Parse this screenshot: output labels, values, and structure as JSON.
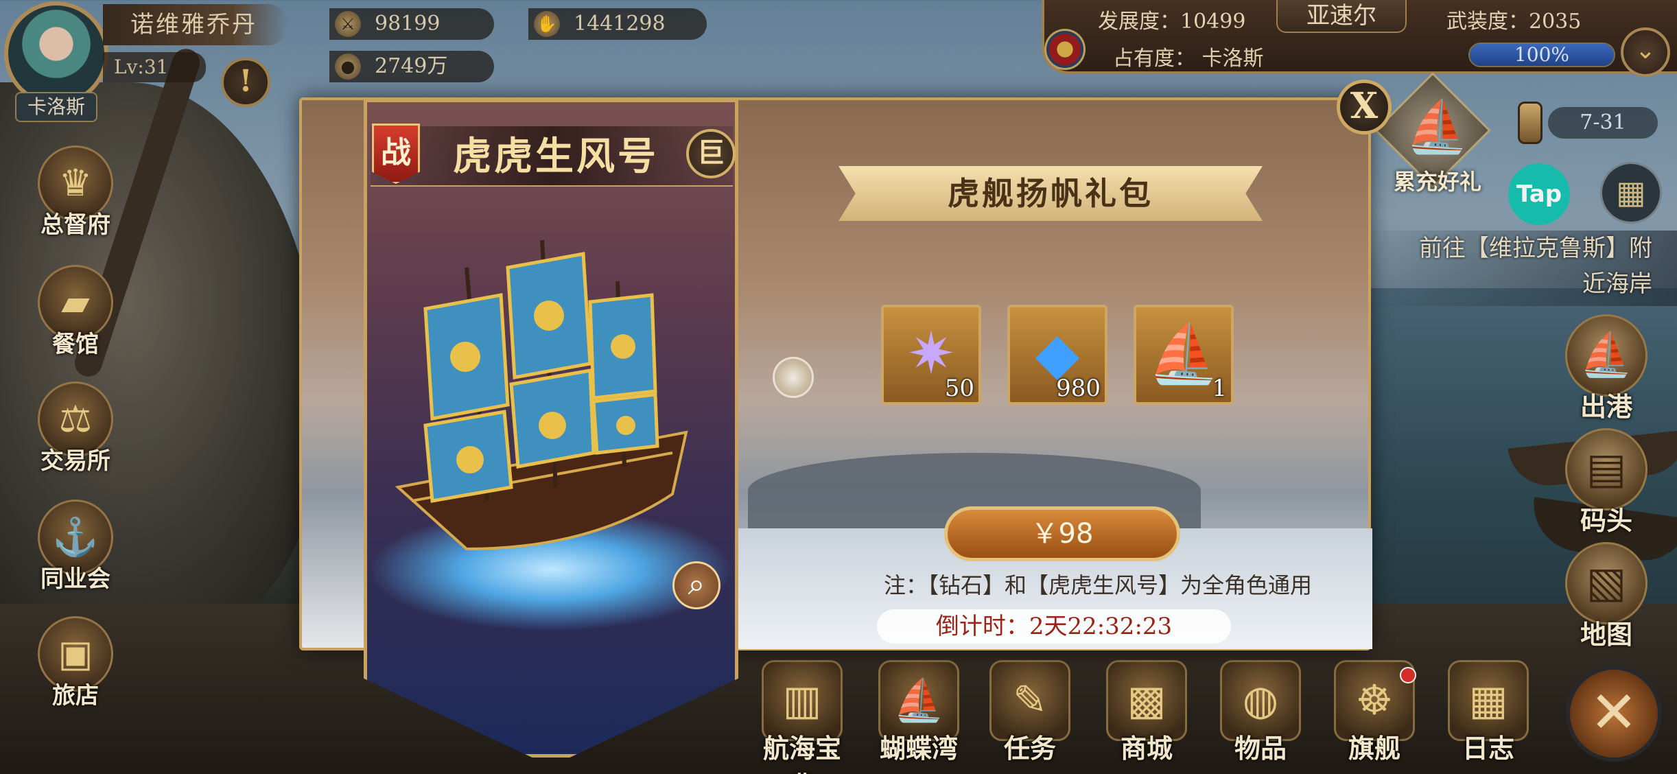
{
  "player": {
    "name": "诺维雅乔丹",
    "level": "Lv:31",
    "city": "卡洛斯",
    "resources": {
      "silver": "98199",
      "gold": "2749万",
      "trade": "1441298"
    }
  },
  "city_bar": {
    "development": "发展度：10499",
    "name": "亚速尔",
    "armament": "武装度：2035",
    "occupancy_label": "占有度：  卡洛斯",
    "occupancy_pct": "100%",
    "occupancy_value": 1.0
  },
  "left_menu": [
    {
      "label": "总督府",
      "icon": "crown-icon"
    },
    {
      "label": "餐馆",
      "icon": "gold-bar-icon"
    },
    {
      "label": "交易所",
      "icon": "scale-icon"
    },
    {
      "label": "同业会",
      "icon": "anchor-shield-icon"
    },
    {
      "label": "旅店",
      "icon": "bed-icon"
    }
  ],
  "right_panel": {
    "event_label": "累充好礼",
    "event_date": "7-31",
    "tap_label": "Tap",
    "quest_text_1": "前往【维拉克鲁斯】附",
    "quest_text_2": "近海岸"
  },
  "right_menu": [
    {
      "label": "出港",
      "icon": "sailing-ship-icon"
    },
    {
      "label": "码头",
      "icon": "dock-icon"
    },
    {
      "label": "地图",
      "icon": "scroll-map-icon"
    }
  ],
  "bottom_menu": [
    {
      "label": "航海宝典",
      "icon": "book-icon"
    },
    {
      "label": "蝴蝶湾",
      "icon": "bay-ship-icon"
    },
    {
      "label": "任务",
      "icon": "quill-scroll-icon"
    },
    {
      "label": "商城",
      "icon": "treasure-chest-icon"
    },
    {
      "label": "物品",
      "icon": "bag-icon"
    },
    {
      "label": "旗舰",
      "icon": "helm-wheel-icon"
    },
    {
      "label": "日志",
      "icon": "journal-icon"
    }
  ],
  "modal": {
    "ship_type_badge": "战",
    "ship_name": "虎虎生风号",
    "ship_size_badge": "巨",
    "pack_title": "虎舰扬帆礼包",
    "items": [
      {
        "name": "star-crystal",
        "qty": "50",
        "icon": "star-gem-icon"
      },
      {
        "name": "diamond",
        "qty": "980",
        "icon": "blue-gem-icon"
      },
      {
        "name": "ship",
        "qty": "1",
        "icon": "ship-icon"
      }
    ],
    "price": "￥98",
    "note": "注：【钻石】和【虎虎生风号】为全角色通用",
    "countdown": "倒计时：2天22:32:23"
  },
  "colors": {
    "accent_gold": "#c9a25e",
    "buy_button": "#c2702a",
    "countdown_text": "#9a2417",
    "tap_green": "#19c6b6"
  }
}
